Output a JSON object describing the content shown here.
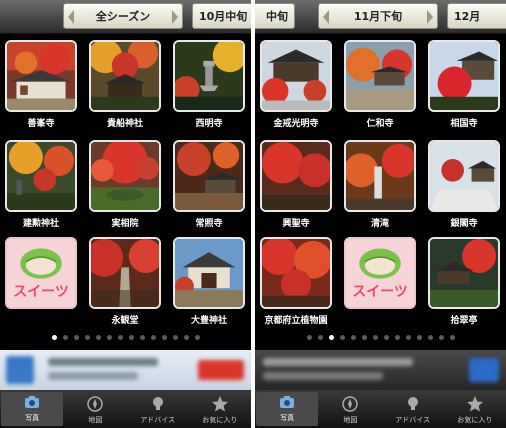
{
  "left": {
    "season": {
      "prev_label": "",
      "current_label": "全シーズン",
      "next_label": "10月中旬"
    },
    "items": [
      {
        "name": "善峯寺"
      },
      {
        "name": "貴船神社"
      },
      {
        "name": "西明寺"
      },
      {
        "name": "建勲神社"
      },
      {
        "name": "実相院"
      },
      {
        "name": "常照寺"
      },
      {
        "name": "",
        "sweets_label": "スイーツ"
      },
      {
        "name": "永観堂"
      },
      {
        "name": "大豊神社"
      }
    ],
    "page_dots": {
      "count": 14,
      "active": 0
    }
  },
  "right": {
    "season": {
      "prev_label": "中旬",
      "current_label": "11月下旬",
      "next_label": "12月"
    },
    "items": [
      {
        "name": "金戒光明寺"
      },
      {
        "name": "仁和寺"
      },
      {
        "name": "相国寺"
      },
      {
        "name": "興聖寺"
      },
      {
        "name": "清滝"
      },
      {
        "name": "銀閣寺"
      },
      {
        "name": "京都府立植物園"
      },
      {
        "name": "",
        "sweets_label": "スイーツ"
      },
      {
        "name": "拾翠亭"
      }
    ],
    "page_dots": {
      "count": 14,
      "active": 2
    }
  },
  "tabbar": {
    "items": [
      {
        "label": "写真",
        "icon": "camera-icon",
        "active": true
      },
      {
        "label": "地図",
        "icon": "compass-icon",
        "active": false
      },
      {
        "label": "アドバイス",
        "icon": "lightbulb-icon",
        "active": false
      },
      {
        "label": "お気に入り",
        "icon": "star-icon",
        "active": false
      }
    ]
  },
  "colors": {
    "background": "#000000",
    "label": "#ffffff",
    "sweets_bg": "#f7d3d7",
    "sweets_text": "#e64b6d",
    "tab_active": "#4a4a4a"
  }
}
